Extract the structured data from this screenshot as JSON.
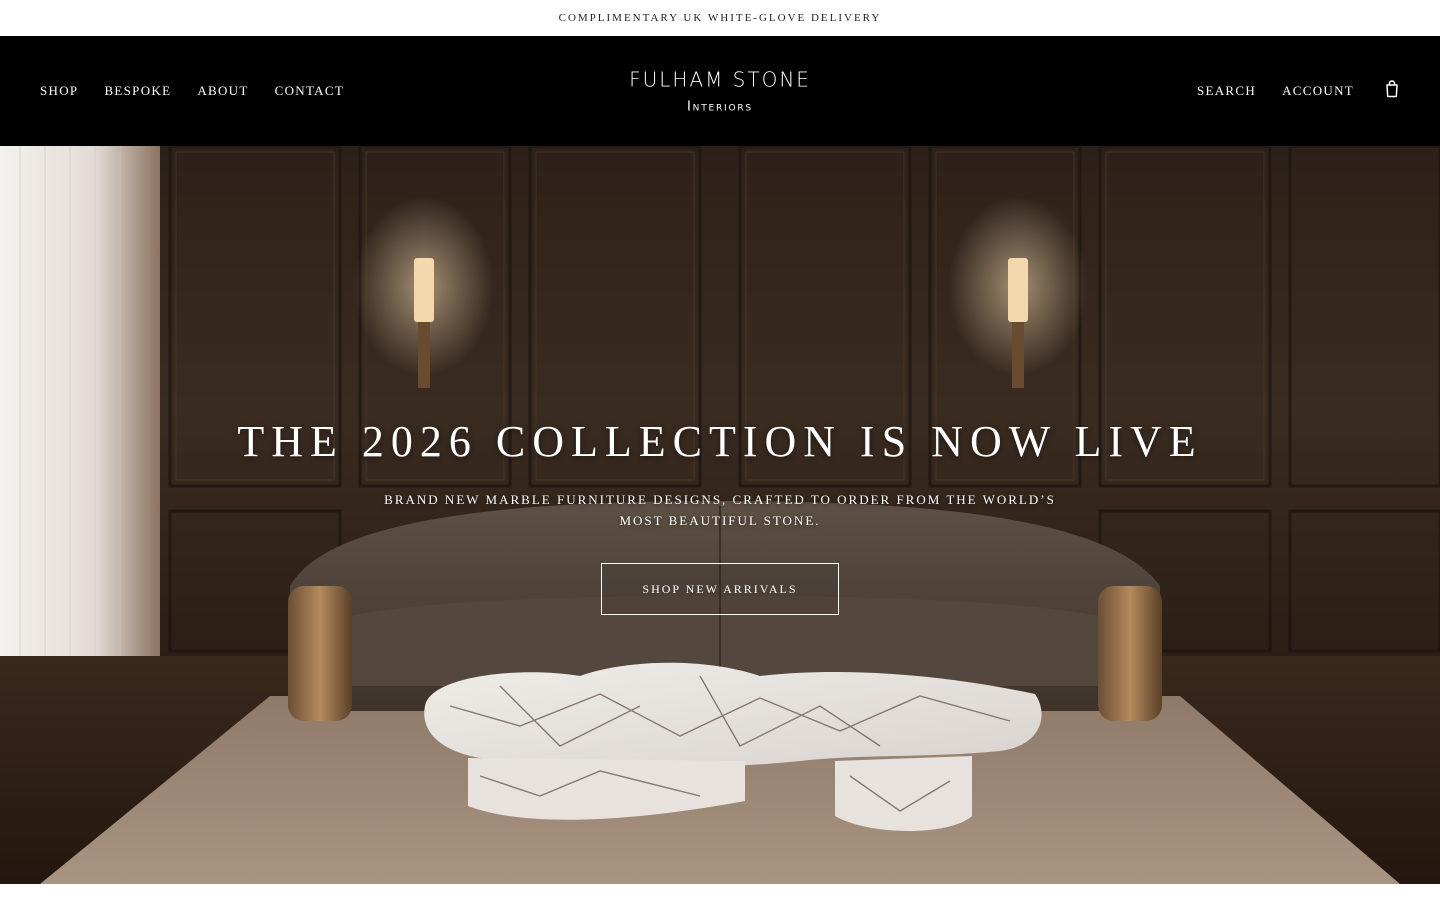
{
  "announcement": {
    "text": "COMPLIMENTARY UK WHITE-GLOVE DELIVERY"
  },
  "nav": {
    "items": [
      {
        "label": "SHOP"
      },
      {
        "label": "BESPOKE"
      },
      {
        "label": "ABOUT"
      },
      {
        "label": "CONTACT"
      }
    ]
  },
  "logo": {
    "main": "FULHAM STONE",
    "sub": "Interiors"
  },
  "utility": {
    "search_label": "SEARCH",
    "account_label": "ACCOUNT",
    "cart_icon": "shopping-bag-icon"
  },
  "hero": {
    "title": "THE 2026 COLLECTION IS NOW LIVE",
    "subtitle": "BRAND NEW MARBLE FURNITURE DESIGNS, CRAFTED TO ORDER FROM THE WORLD’S MOST BEAUTIFUL STONE.",
    "cta_label": "SHOP NEW ARRIVALS"
  },
  "colors": {
    "header_bg": "#000000",
    "announcement_bg": "#ffffff",
    "hero_text": "#ffffff"
  }
}
